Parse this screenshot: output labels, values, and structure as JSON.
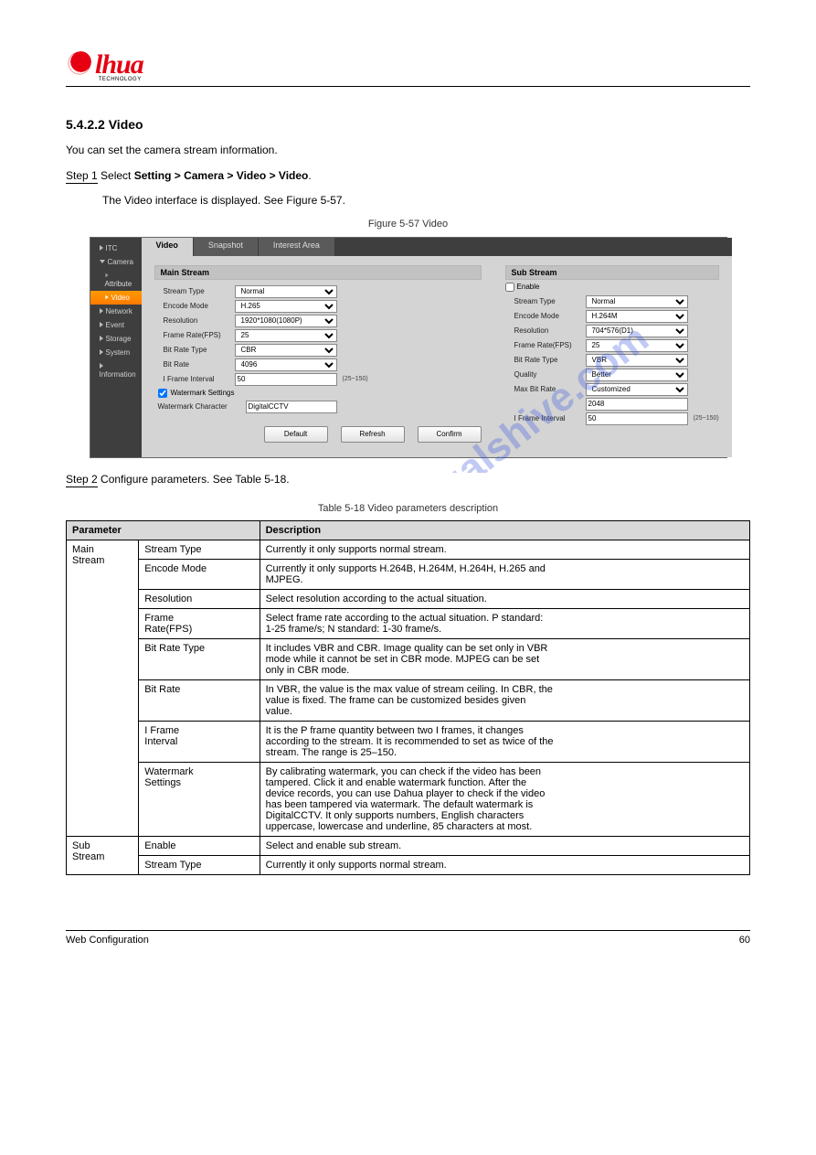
{
  "logo": {
    "text": "lhua",
    "sub": "TECHNOLOGY"
  },
  "section": {
    "num": "5.4.2.2",
    "title": "Video"
  },
  "intro": "You can set the camera stream information.",
  "steps": {
    "s1_prefix": "Step 1",
    "s1_body_a": " Select ",
    "s1_body_b": "Setting > Camera > Video > Video",
    "s1_body_c": ".",
    "interface_text": "The Video interface is displayed. See Figure 5-57.",
    "fig_caption": "Figure 5-57 Video",
    "s2_prefix": "Step 2",
    "s2_body": " Configure parameters. See Table 5-18.",
    "table_caption": "Table 5-18 Video parameters description"
  },
  "screenshot": {
    "sidebar": {
      "itc": "ITC",
      "camera": "Camera",
      "attribute": "Attribute",
      "video": "Video",
      "network": "Network",
      "event": "Event",
      "storage": "Storage",
      "system": "System",
      "information": "Information"
    },
    "tabs": {
      "video": "Video",
      "snapshot": "Snapshot",
      "interest": "Interest Area"
    },
    "main": {
      "header": "Main Stream",
      "stream_type_l": "Stream Type",
      "stream_type_v": "Normal",
      "encode_l": "Encode Mode",
      "encode_v": "H.265",
      "resolution_l": "Resolution",
      "resolution_v": "1920*1080(1080P)",
      "fps_l": "Frame Rate(FPS)",
      "fps_v": "25",
      "brtype_l": "Bit Rate Type",
      "brtype_v": "CBR",
      "br_l": "Bit Rate",
      "br_v": "4096",
      "ifi_l": "I Frame Interval",
      "ifi_v": "50",
      "ifi_hint": "(25~150)",
      "wm_chk": "Watermark Settings",
      "wmchar_l": "Watermark Character",
      "wmchar_v": "DigitalCCTV"
    },
    "sub": {
      "header": "Sub Stream",
      "enable": "Enable",
      "stream_type_l": "Stream Type",
      "stream_type_v": "Normal",
      "encode_l": "Encode Mode",
      "encode_v": "H.264M",
      "resolution_l": "Resolution",
      "resolution_v": "704*576(D1)",
      "fps_l": "Frame Rate(FPS)",
      "fps_v": "25",
      "brtype_l": "Bit Rate Type",
      "brtype_v": "VBR",
      "quality_l": "Quality",
      "quality_v": "Better",
      "maxbr_l": "Max Bit Rate",
      "maxbr_v": "Customized",
      "maxbr2_v": "2048",
      "ifi_l": "I Frame Interval",
      "ifi_v": "50",
      "ifi_hint": "(25~150)"
    },
    "buttons": {
      "default": "Default",
      "refresh": "Refresh",
      "confirm": "Confirm"
    }
  },
  "table": {
    "h1": "Parameter",
    "h2": "Description",
    "group_main": "Main\nStream",
    "group_sub": "Sub\nStream",
    "rows": {
      "r0p": "Stream Type",
      "r0d": "Currently it only supports normal stream.",
      "r1p": "Encode Mode",
      "r1d": "Currently it only supports H.264B, H.264M, H.264H, H.265 and\nMJPEG.",
      "r2p": "Resolution",
      "r2d": "Select resolution according to the actual situation.",
      "r3p": "Frame\nRate(FPS)",
      "r3d": "Select frame rate according to the actual situation. P standard:\n1-25 frame/s; N standard: 1-30 frame/s.",
      "r4p": "Bit Rate Type",
      "r4d": "It includes VBR and CBR. Image quality can be set only in VBR\nmode while it cannot be set in CBR mode. MJPEG can be set\nonly in CBR mode.",
      "r5p": "Bit Rate",
      "r5d": "In VBR, the value is the max value of stream ceiling. In CBR, the\nvalue is fixed. The frame can be customized besides given\nvalue.",
      "r6p": "I Frame\nInterval",
      "r6d": "It is the P frame quantity between two I frames, it changes\naccording to the stream. It is recommended to set as twice of the\nstream. The range is 25–150.",
      "r7p": "Watermark\nSettings",
      "r7d": "By calibrating watermark, you can check if the video has been\ntampered. Click it and enable watermark function. After the\ndevice records, you can use Dahua player to check if the video\nhas been tampered via watermark. The default watermark is\nDigitalCCTV. It only supports numbers, English characters\nuppercase, lowercase and underline, 85 characters at most.",
      "r8p": "Enable",
      "r8d": "Select and enable sub stream.",
      "r9p": "Stream Type",
      "r9d": "Currently it only supports normal stream."
    }
  },
  "footer": {
    "left": "Web Configuration",
    "right": "60"
  },
  "watermark_url": "manualshive.com"
}
